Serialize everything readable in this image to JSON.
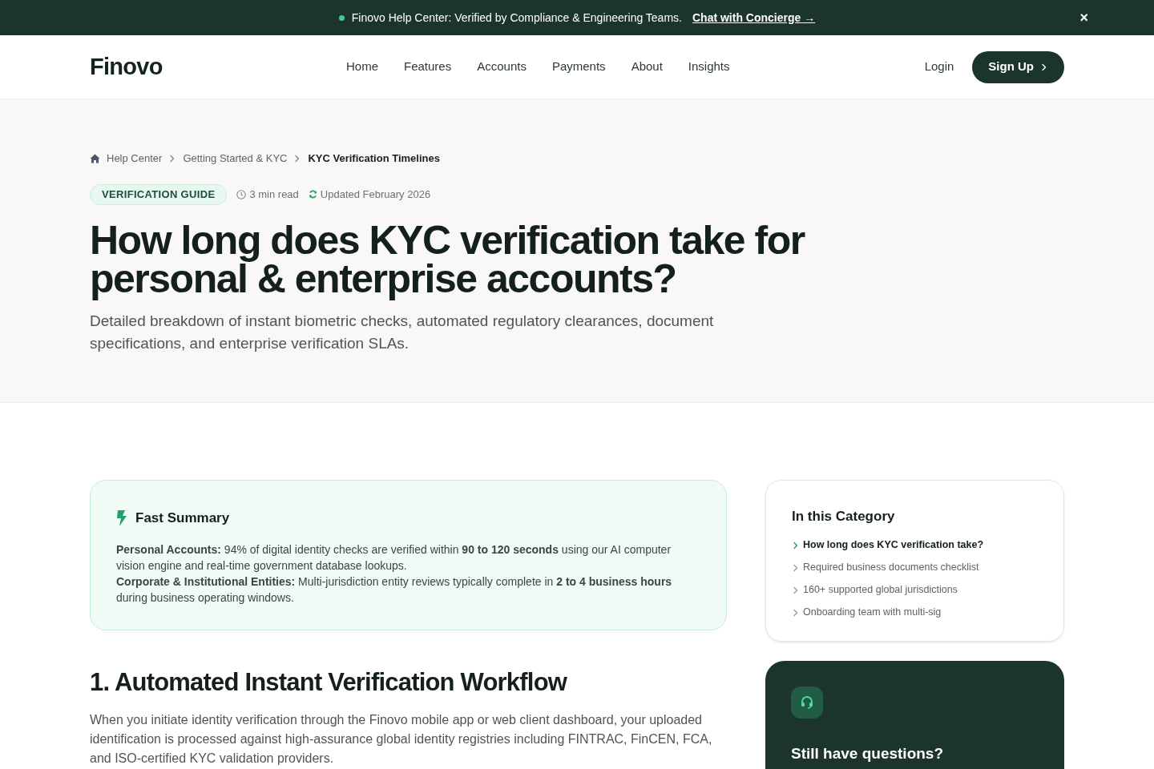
{
  "announcement": {
    "text": "Finovo Help Center: Verified by Compliance & Engineering Teams.",
    "link": "Chat with Concierge →",
    "close": "×"
  },
  "header": {
    "logo": "Finovo",
    "nav": [
      {
        "label": "Home"
      },
      {
        "label": "Features"
      },
      {
        "label": "Accounts"
      },
      {
        "label": "Payments"
      },
      {
        "label": "About"
      },
      {
        "label": "Insights"
      }
    ],
    "login": "Login",
    "signup": "Sign Up"
  },
  "breadcrumb": [
    {
      "label": "Help Center",
      "current": false
    },
    {
      "label": "Getting Started & KYC",
      "current": false
    },
    {
      "label": "KYC Verification Timelines",
      "current": true
    }
  ],
  "badge": "VERIFICATION GUIDE",
  "read_time": "3 min read",
  "updated": "Updated February 2026",
  "title": "How long does KYC verification take for personal & enterprise accounts?",
  "subtitle": "Detailed breakdown of instant biometric checks, automated regulatory clearances, document specifications, and enterprise verification SLAs.",
  "summary": {
    "title": "Fast Summary",
    "paragraphs": [
      "**Personal Accounts:** 94% of digital identity checks are verified within **90 to 120 seconds** using our AI computer vision engine and real-time government database lookups.",
      "**Corporate & Institutional Entities:** Multi-jurisdiction entity reviews typically complete in **2 to 4 business hours** during business operating windows."
    ]
  },
  "section": {
    "heading": "1. Automated Instant Verification Workflow",
    "body": "When you initiate identity verification through the Finovo mobile app or web client dashboard, your uploaded identification is processed against high-assurance global identity registries including FINTRAC, FinCEN, FCA, and ISO-certified KYC validation providers."
  },
  "category": {
    "title": "In this Category",
    "items": [
      {
        "label": "How long does KYC verification take?",
        "selected": true
      },
      {
        "label": "Required business documents checklist",
        "selected": false
      },
      {
        "label": "160+ supported global jurisdictions",
        "selected": false
      },
      {
        "label": "Onboarding team with multi-sig",
        "selected": false
      }
    ]
  },
  "help_card": {
    "title": "Still have questions?"
  }
}
